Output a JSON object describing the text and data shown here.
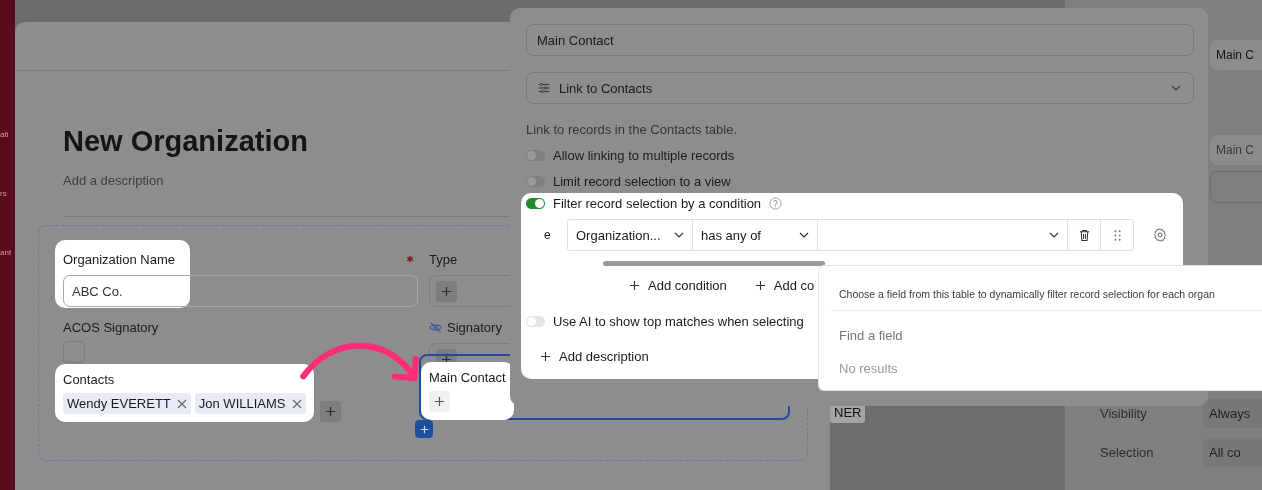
{
  "sidebar": {
    "items": [
      {
        "label": "ati"
      },
      {
        "label": "rs"
      },
      {
        "label": "ant"
      }
    ]
  },
  "record": {
    "title": "New Organization",
    "description_placeholder": "Add a description",
    "fields": [
      {
        "kind": "text",
        "label": "Organization Name",
        "value": "ABC Co.",
        "required": true,
        "highlighted": true
      },
      {
        "kind": "add",
        "label": "Type"
      },
      {
        "kind": "checkbox",
        "label": "ACOS Signatory",
        "checked": false
      },
      {
        "kind": "add",
        "label": "Signatory",
        "hidden": true
      },
      {
        "kind": "link",
        "label": "Contacts",
        "chips": [
          "Wendy EVERETT",
          "Jon WILLIAMS"
        ],
        "highlighted": true,
        "selected": false
      },
      {
        "kind": "link",
        "label": "Main Contact",
        "highlighted": true,
        "selected": true
      }
    ],
    "side_chip": "NER"
  },
  "field_editor": {
    "name": "Main Contact",
    "type": "Link to Contacts",
    "description": "Link to records in the Contacts table.",
    "options": [
      {
        "label": "Allow linking to multiple records",
        "on": false
      },
      {
        "label": "Limit record selection to a view",
        "on": false
      }
    ],
    "filter": {
      "label": "Filter record selection by a condition",
      "on": true,
      "prefix": "e",
      "field": "Organization...",
      "operator": "has any of",
      "actions": [
        "Add condition",
        "Add co"
      ]
    },
    "ai_option": {
      "label": "Use AI to show top matches when selecting",
      "on": false
    },
    "add_description": "Add description"
  },
  "field_dropdown": {
    "hint": "Choose a field from this table to dynamically filter record selection for each organ",
    "search_placeholder": "Find a field",
    "empty": "No results"
  },
  "right_panel": {
    "inputs": [
      {
        "value": "Main C"
      },
      {
        "placeholder": "Main C"
      }
    ],
    "settings": [
      {
        "label": "Visibility",
        "value": "Always"
      },
      {
        "label": "Selection",
        "value": "All co"
      }
    ]
  }
}
